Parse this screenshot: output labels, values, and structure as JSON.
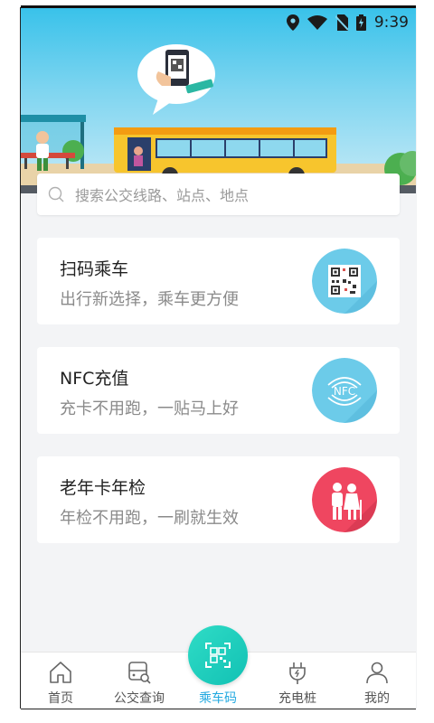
{
  "status_bar": {
    "time": "9:39"
  },
  "search": {
    "placeholder": "搜索公交线路、站点、地点"
  },
  "cards": [
    {
      "title": "扫码乘车",
      "subtitle": "出行新选择，乘车更方便",
      "icon": "qr-code-icon",
      "color": "#6ccbe9"
    },
    {
      "title": "NFC充值",
      "subtitle": "充卡不用跑，一贴马上好",
      "icon": "nfc-icon",
      "color": "#6ccbe9"
    },
    {
      "title": "老年卡年检",
      "subtitle": "年检不用跑，一刷就生效",
      "icon": "elderly-couple-icon",
      "color": "#ef4660"
    }
  ],
  "tabbar": {
    "items": [
      {
        "label": "首页",
        "icon": "home-icon"
      },
      {
        "label": "公交查询",
        "icon": "bus-search-icon"
      },
      {
        "label": "乘车码",
        "icon": "scan-code-icon",
        "active": true
      },
      {
        "label": "充电桩",
        "icon": "charging-plug-icon"
      },
      {
        "label": "我的",
        "icon": "person-icon"
      }
    ]
  }
}
